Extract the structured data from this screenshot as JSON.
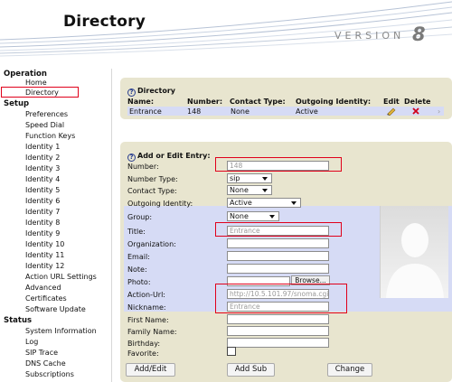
{
  "header": {
    "title": "Directory",
    "version_label": "VERSION",
    "version_number": "8"
  },
  "sidebar": {
    "operation": "Operation",
    "operation_items": [
      "Home",
      "Directory"
    ],
    "setup": "Setup",
    "setup_items": [
      "Preferences",
      "Speed Dial",
      "Function Keys",
      "Identity 1",
      "Identity 2",
      "Identity 3",
      "Identity 4",
      "Identity 5",
      "Identity 6",
      "Identity 7",
      "Identity 8",
      "Identity 9",
      "Identity 10",
      "Identity 11",
      "Identity 12",
      "Action URL Settings",
      "Advanced",
      "Certificates",
      "Software Update"
    ],
    "status": "Status",
    "status_items": [
      "System Information",
      "Log",
      "SIP Trace",
      "DNS Cache",
      "Subscriptions"
    ]
  },
  "directory": {
    "title": "Directory",
    "columns": {
      "name": "Name:",
      "number": "Number:",
      "contact_type": "Contact Type:",
      "outgoing_identity": "Outgoing Identity:",
      "edit": "Edit",
      "delete": "Delete"
    },
    "rows": [
      {
        "name": "Entrance",
        "number": "148",
        "contact_type": "None",
        "outgoing_identity": "Active"
      }
    ]
  },
  "form": {
    "title": "Add or Edit Entry:",
    "number_label": "Number:",
    "number_value": "148",
    "number_type_label": "Number Type:",
    "number_type_value": "sip",
    "contact_type_label": "Contact Type:",
    "contact_type_value": "None",
    "outgoing_identity_label": "Outgoing Identity:",
    "outgoing_identity_value": "Active",
    "group_label": "Group:",
    "group_value": "None",
    "title_label": "Title:",
    "title_value": "Entrance",
    "organization_label": "Organization:",
    "email_label": "Email:",
    "note_label": "Note:",
    "photo_label": "Photo:",
    "browse_label": "Browse...",
    "action_url_label": "Action-Url:",
    "action_url_value": "http://10.5.101.97/snoma.cgi",
    "nickname_label": "Nickname:",
    "nickname_value": "Entrance",
    "first_name_label": "First Name:",
    "family_name_label": "Family Name:",
    "birthday_label": "Birthday:",
    "favorite_label": "Favorite:",
    "add_edit_button": "Add/Edit",
    "add_sub_button": "Add Sub",
    "change_button": "Change"
  },
  "colors": {
    "panel": "#e8e5cf",
    "highlight_row": "#d6dbf5",
    "annotation_red": "#e0001b"
  }
}
